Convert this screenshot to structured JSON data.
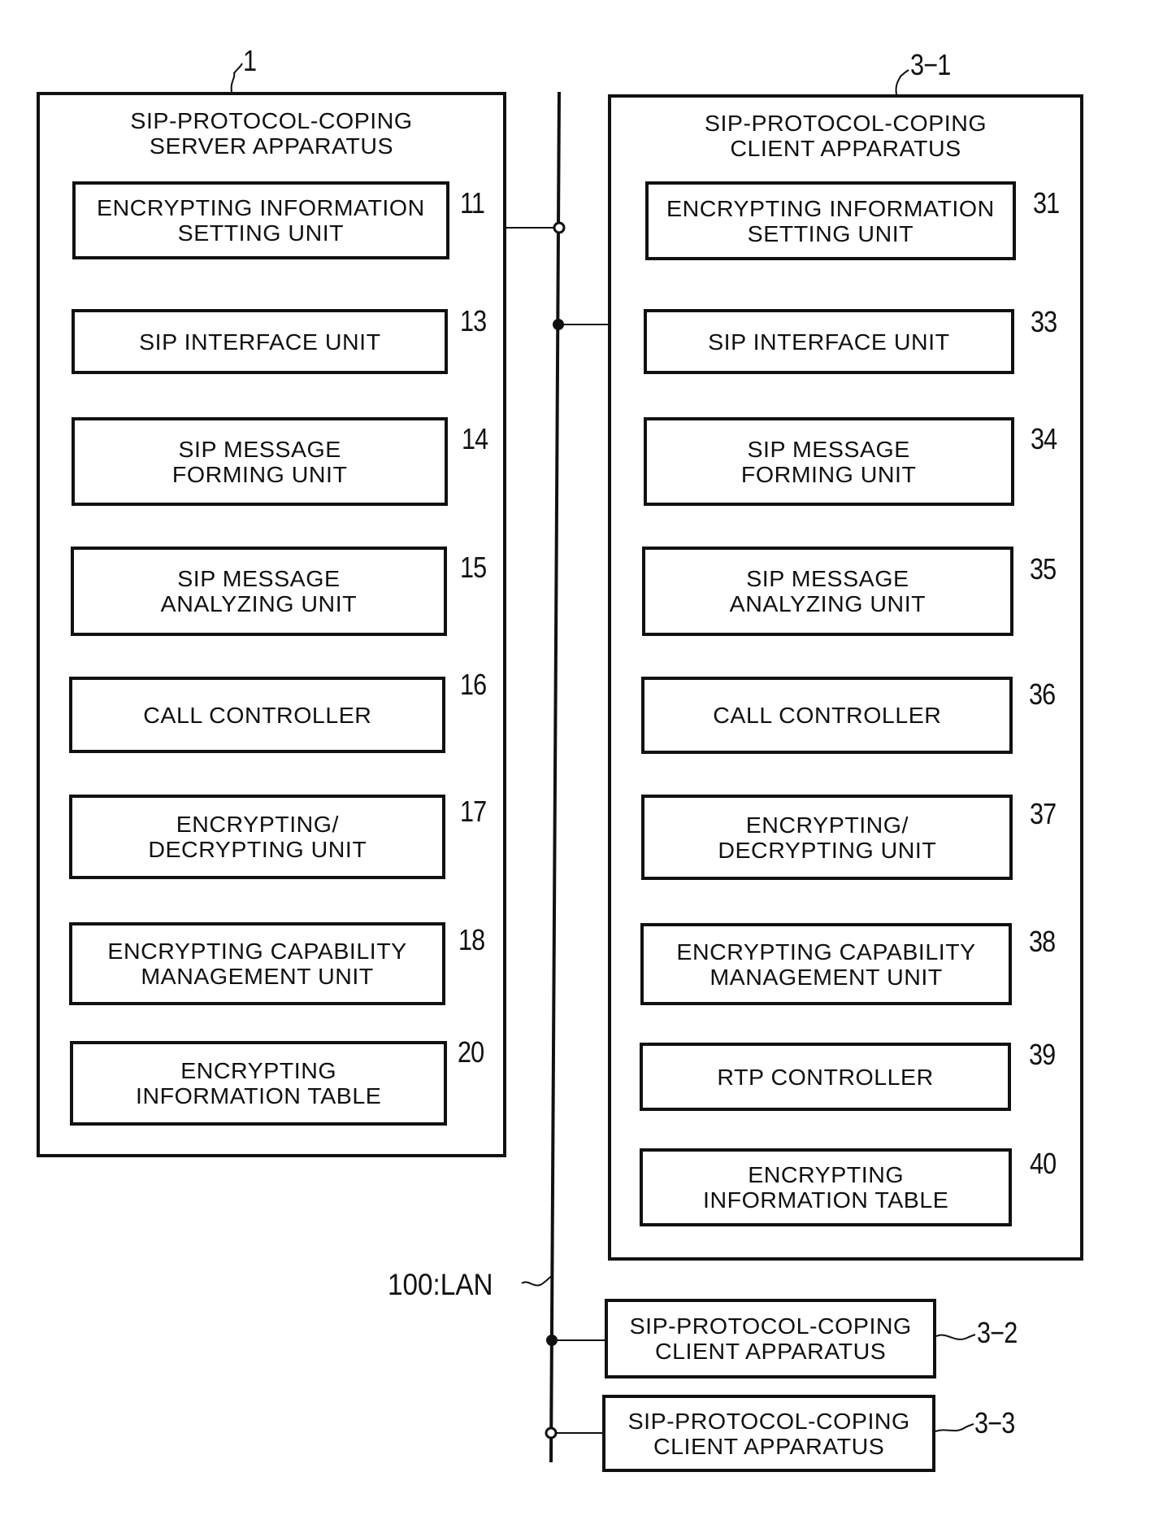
{
  "lan": {
    "label": "100:LAN"
  },
  "server": {
    "ref": "1",
    "title": "SIP-PROTOCOL-COPING\nSERVER APPARATUS",
    "units": [
      {
        "ref": "11",
        "label": "ENCRYPTING INFORMATION\nSETTING UNIT"
      },
      {
        "ref": "13",
        "label": "SIP INTERFACE UNIT"
      },
      {
        "ref": "14",
        "label": "SIP MESSAGE\nFORMING UNIT"
      },
      {
        "ref": "15",
        "label": "SIP MESSAGE\nANALYZING UNIT"
      },
      {
        "ref": "16",
        "label": "CALL CONTROLLER"
      },
      {
        "ref": "17",
        "label": "ENCRYPTING/\nDECRYPTING UNIT"
      },
      {
        "ref": "18",
        "label": "ENCRYPTING CAPABILITY\nMANAGEMENT UNIT"
      },
      {
        "ref": "20",
        "label": "ENCRYPTING\nINFORMATION TABLE"
      }
    ]
  },
  "client": {
    "ref": "3-1",
    "title": "SIP-PROTOCOL-COPING\nCLIENT APPARATUS",
    "units": [
      {
        "ref": "31",
        "label": "ENCRYPTING INFORMATION\nSETTING UNIT"
      },
      {
        "ref": "33",
        "label": "SIP INTERFACE UNIT"
      },
      {
        "ref": "34",
        "label": "SIP MESSAGE\nFORMING UNIT"
      },
      {
        "ref": "35",
        "label": "SIP MESSAGE\nANALYZING UNIT"
      },
      {
        "ref": "36",
        "label": "CALL CONTROLLER"
      },
      {
        "ref": "37",
        "label": "ENCRYPTING/\nDECRYPTING UNIT"
      },
      {
        "ref": "38",
        "label": "ENCRYPTING CAPABILITY\nMANAGEMENT UNIT"
      },
      {
        "ref": "39",
        "label": "RTP CONTROLLER"
      },
      {
        "ref": "40",
        "label": "ENCRYPTING\nINFORMATION TABLE"
      }
    ]
  },
  "other_clients": [
    {
      "ref": "3-2",
      "label": "SIP-PROTOCOL-COPING\nCLIENT APPARATUS"
    },
    {
      "ref": "3-3",
      "label": "SIP-PROTOCOL-COPING\nCLIENT APPARATUS"
    }
  ]
}
